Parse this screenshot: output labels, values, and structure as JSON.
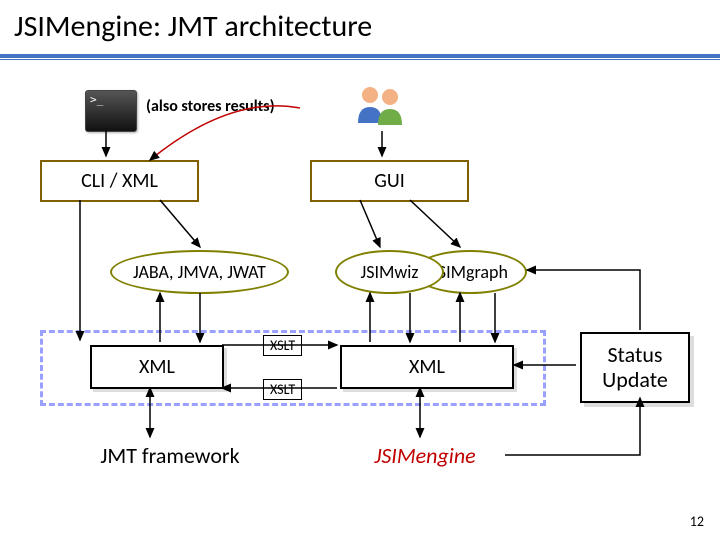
{
  "title": "JSIMengine: JMT architecture",
  "note": "(also stores results)",
  "cli_box": "CLI / XML",
  "gui_box": "GUI",
  "jaba_oval": "JABA, JMVA, JWAT",
  "jsimwiz_oval": "JSIMwiz",
  "jsimgraph_oval": "JSIMgraph",
  "xml_left": "XML",
  "xml_right": "XML",
  "xslt1": "XSLT",
  "xslt2": "XSLT",
  "jmt_framework": "JMT framework",
  "jsimengine": "JSIMengine",
  "status_line1": "Status",
  "status_line2": "Update",
  "page_num": "12",
  "icons": {
    "terminal": "terminal-icon",
    "users": "users-icon"
  }
}
